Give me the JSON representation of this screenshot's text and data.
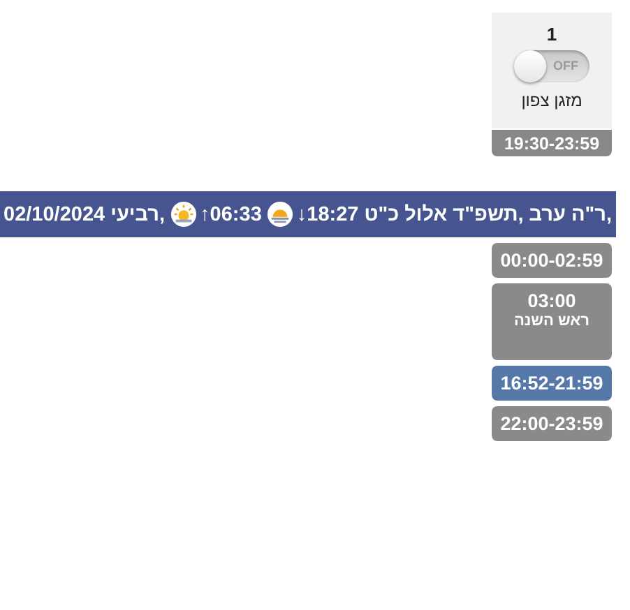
{
  "device_card": {
    "number": "1",
    "switch": {
      "on": false,
      "label": "OFF"
    },
    "name": "מזגן צפון"
  },
  "partial_slot": {
    "time": "19:30-23:59"
  },
  "day_header": {
    "date": "02/10/2024",
    "weekday": "רביעי,",
    "sunrise": "↑06:33",
    "sunset": "↓18:27",
    "hebrew_date": "כ\"ט אלול תשפ\"ד, ערב ר\"ה,"
  },
  "slots": [
    {
      "time": "00:00-02:59",
      "selected": false
    },
    {
      "time": "03:00",
      "note": "ראש השנה",
      "selected": false
    },
    {
      "time": "16:52-21:59",
      "selected": true
    },
    {
      "time": "22:00-23:59",
      "selected": false
    }
  ]
}
